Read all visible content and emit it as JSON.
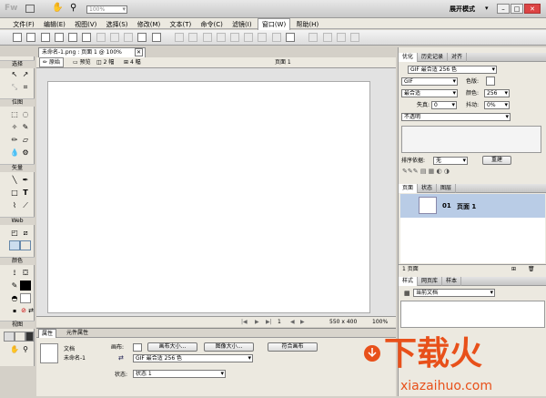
{
  "app": {
    "logo": "Fw",
    "zoom": "100%",
    "mode": "展开模式"
  },
  "menu": [
    "文件(F)",
    "编辑(E)",
    "视图(V)",
    "选择(S)",
    "修改(M)",
    "文本(T)",
    "命令(C)",
    "滤镜(I)",
    "窗口(W)",
    "帮助(H)"
  ],
  "tools": {
    "select": "选择",
    "bitmap": "位图",
    "vector": "矢量",
    "web": "Web",
    "colors": "颜色",
    "view": "视图"
  },
  "document": {
    "tab_title": "未命名-1.png : 页面 1 @ 100%",
    "views": [
      "原始",
      "预览",
      "2 幅",
      "4 幅"
    ],
    "page_label": "页面 1",
    "status": {
      "frame": "1",
      "size": "550 x 400",
      "zoom": "100%"
    }
  },
  "properties": {
    "tabs": [
      "属性",
      "元件属性"
    ],
    "type": "文档",
    "name": "未命名-1",
    "canvas_label": "画布:",
    "canvas_size_btn": "画布大小...",
    "image_size_btn": "图像大小...",
    "fit_canvas_btn": "符合画布",
    "export_format": "GIF 最合适 256 色",
    "state_label": "状态:",
    "state_value": "状态 1"
  },
  "optimize": {
    "tabs": [
      "优化",
      "历史记录",
      "对齐"
    ],
    "preset": "GIF 最合适 256 色",
    "format": "GIF",
    "matte_label": "色版:",
    "palette": "最合适",
    "colors_label": "颜色:",
    "colors_value": "256",
    "loss_label": "失真:",
    "loss_value": "0",
    "dither_label": "抖动:",
    "dither_value": "0%",
    "transparency": "不透明",
    "sort_label": "排序依据:",
    "sort_value": "无",
    "rebuild_btn": "重建"
  },
  "pages": {
    "tabs": [
      "页面",
      "状态",
      "图层"
    ],
    "items": [
      {
        "number": "01",
        "name": "页面 1"
      }
    ],
    "footer": "1 页面"
  },
  "styles": {
    "tabs": [
      "样式",
      "网页库",
      "样本"
    ],
    "current": "当前文档"
  },
  "watermark": {
    "logo_text": "下载火",
    "url": "xiazaihuo.com",
    "color": "#e8501a"
  }
}
